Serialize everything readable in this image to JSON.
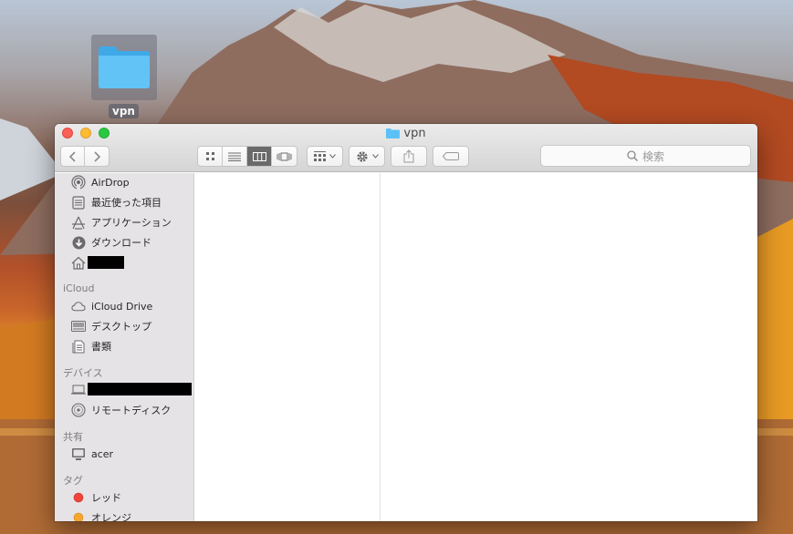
{
  "desktop": {
    "folder_label": "vpn"
  },
  "window": {
    "title": "vpn",
    "search_placeholder": "検索"
  },
  "sidebar": {
    "favorites": [
      {
        "label": "AirDrop",
        "icon": "airdrop-icon"
      },
      {
        "label": "最近使った項目",
        "icon": "recents-icon"
      },
      {
        "label": "アプリケーション",
        "icon": "applications-icon"
      },
      {
        "label": "ダウンロード",
        "icon": "downloads-icon"
      },
      {
        "label": "",
        "icon": "home-icon",
        "redacted": true
      }
    ],
    "icloud_header": "iCloud",
    "icloud": [
      {
        "label": "iCloud Drive",
        "icon": "cloud-icon"
      },
      {
        "label": "デスクトップ",
        "icon": "desktop-icon"
      },
      {
        "label": "書類",
        "icon": "documents-icon"
      }
    ],
    "devices_header": "デバイス",
    "devices": [
      {
        "label": "",
        "icon": "laptop-icon",
        "redacted": true
      },
      {
        "label": "リモートディスク",
        "icon": "disc-icon"
      }
    ],
    "shared_header": "共有",
    "shared": [
      {
        "label": "acer",
        "icon": "computer-icon"
      }
    ],
    "tags_header": "タグ",
    "tags": [
      {
        "label": "レッド",
        "color": "#f0433a"
      },
      {
        "label": "オレンジ",
        "color": "#f6a530"
      }
    ]
  },
  "colors": {
    "folder_blue": "#5cc1f6",
    "active_view": "#6a6a6a"
  }
}
